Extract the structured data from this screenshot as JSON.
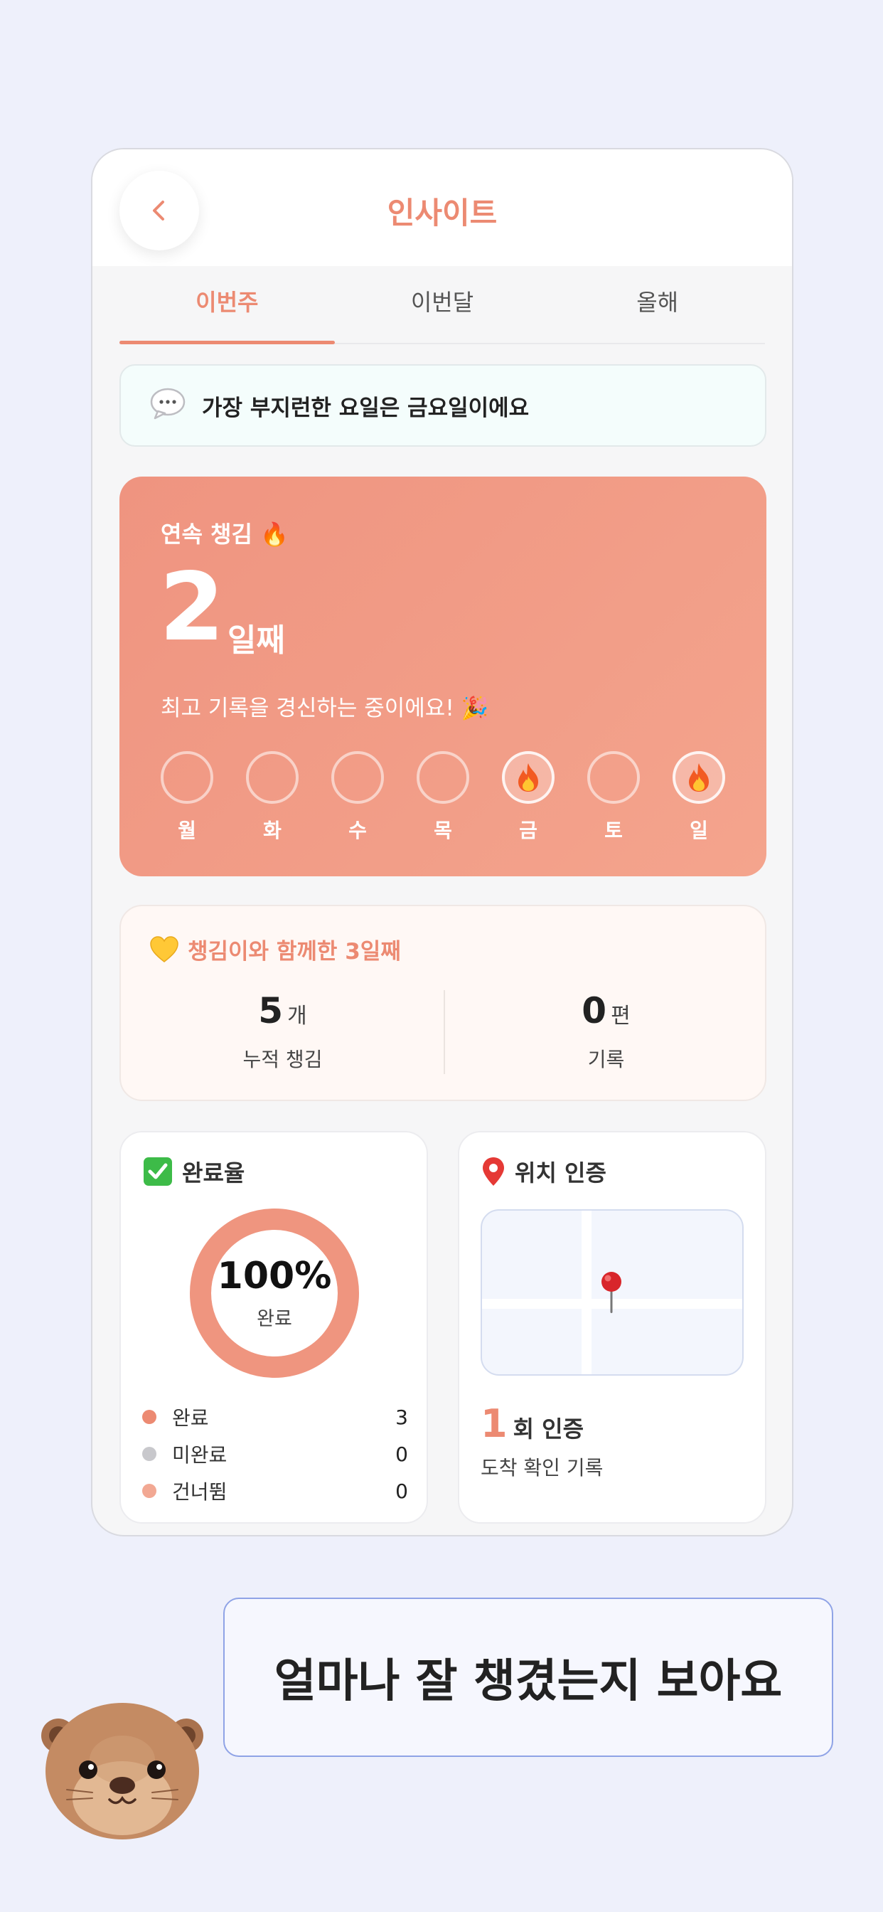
{
  "header": {
    "title": "인사이트",
    "back_icon": "chevron-left-icon"
  },
  "tabs": [
    {
      "label": "이번주",
      "active": true
    },
    {
      "label": "이번달",
      "active": false
    },
    {
      "label": "올해",
      "active": false
    }
  ],
  "banner": {
    "icon": "speech-bubble-icon",
    "text": "가장 부지런한 요일은 금요일이에요"
  },
  "streak": {
    "label": "연속 챙김 🔥",
    "number": "2",
    "unit": "일째",
    "subtitle": "최고 기록을 경신하는 중이에요! 🎉",
    "days": [
      {
        "label": "월",
        "done": false
      },
      {
        "label": "화",
        "done": false
      },
      {
        "label": "수",
        "done": false
      },
      {
        "label": "목",
        "done": false
      },
      {
        "label": "금",
        "done": true
      },
      {
        "label": "토",
        "done": false
      },
      {
        "label": "일",
        "done": true
      }
    ]
  },
  "together": {
    "title": "챙김이와 함께한 3일째",
    "stats": [
      {
        "value": "5",
        "unit": "개",
        "caption": "누적 챙김"
      },
      {
        "value": "0",
        "unit": "편",
        "caption": "기록"
      }
    ]
  },
  "completion": {
    "title": "완료율",
    "percent_text": "100%",
    "percent_label": "완료",
    "fraction": 1.0,
    "legend": [
      {
        "label": "완료",
        "value": "3",
        "color": "#ec8a72"
      },
      {
        "label": "미완료",
        "value": "0",
        "color": "#c8c8cc"
      },
      {
        "label": "건너뜀",
        "value": "0",
        "color": "#f2a893"
      }
    ]
  },
  "location": {
    "title": "위치 인증",
    "count": "1",
    "count_unit": "회 인증",
    "caption": "도착 확인 기록"
  },
  "promo": {
    "text": "얼마나 잘 챙겼는지 보아요"
  },
  "colors": {
    "accent": "#ec8a72",
    "background": "#eef0fb"
  }
}
